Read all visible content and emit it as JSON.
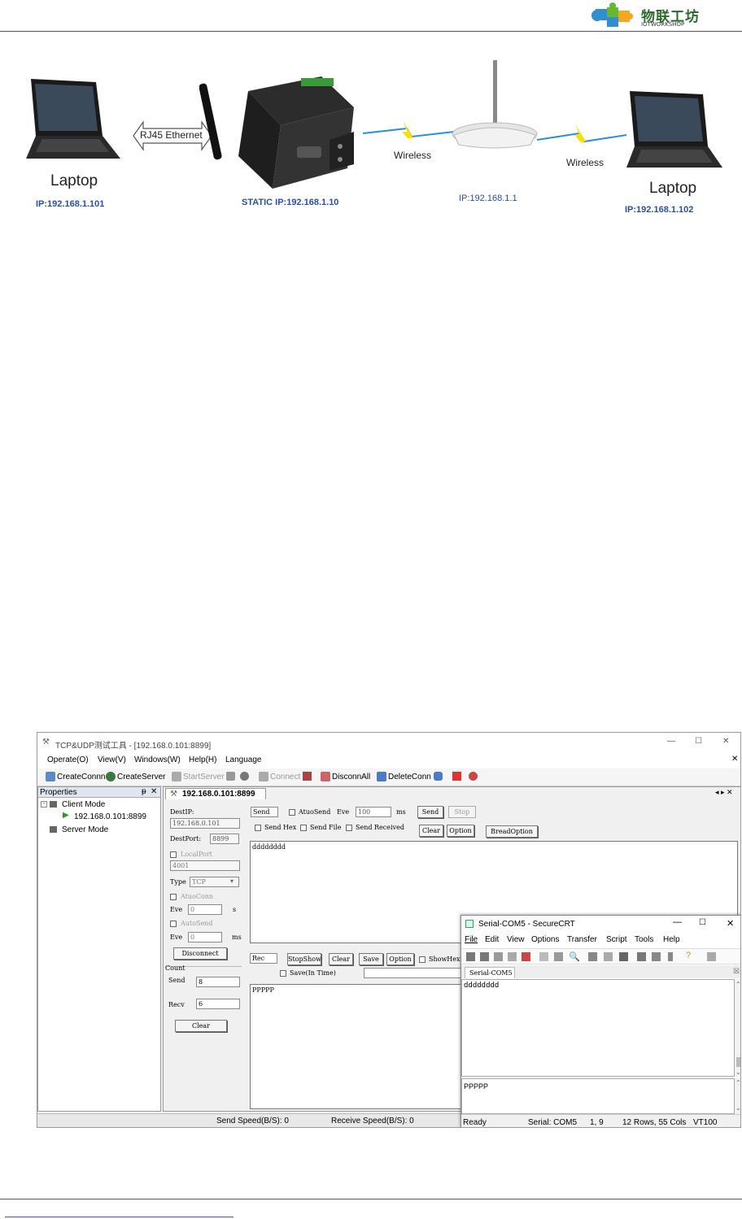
{
  "header": {
    "logo_cn": "物联工坊",
    "logo_en": "IOTWORKSHOP"
  },
  "diagram": {
    "left_label": "Laptop",
    "left_ip": "IP:192.168.1.101",
    "link_label": "RJ45 Ethernet",
    "device_ip": "STATIC IP:192.168.1.10",
    "wireless1": "Wireless",
    "router_ip": "IP:192.168.1.1",
    "wireless2": "Wireless",
    "right_label": "Laptop",
    "right_ip": "IP:192.168.1.102"
  },
  "tcp_tool": {
    "title": "TCP&UDP测试工具 - [192.168.0.101:8899]",
    "window_controls": [
      "—",
      "☐",
      "✕"
    ],
    "menu": [
      "Operate(O)",
      "View(V)",
      "Windows(W)",
      "Help(H)",
      "Language"
    ],
    "toolbar": [
      "CreateConnn",
      "CreateServer",
      "StartServer",
      "Connect",
      "DisconnAll",
      "DeleteConn"
    ],
    "properties_title": "Properties",
    "tree": {
      "client_mode": "Client Mode",
      "connection": "192.168.0.101:8899",
      "server_mode": "Server Mode"
    },
    "tab": "192.168.0.101:8899",
    "dest_ip_label": "DestIP:",
    "dest_ip": "192.168.0.101",
    "dest_port_label": "DestPort:",
    "dest_port": "8899",
    "local_port_label": "LocalPort",
    "local_port": "4001",
    "type_label": "Type",
    "type_value": "TCP",
    "auto_conn_label": "AtuoConn",
    "eve_label": "Eve",
    "eve_value": "0",
    "s_unit": "s",
    "auto_send_label": "AutoSend",
    "eve2_value": "0",
    "ms_unit": "ms",
    "disconnect": "Disconnect",
    "count_label": "Count",
    "send_label": "Send",
    "send_count": "8",
    "recv_label": "Recv",
    "recv_count": "6",
    "clear_left": "Clear",
    "send_box_label": "Send",
    "auto_send2": "AtuoSend",
    "eve3": "Eve",
    "interval": "100",
    "ms2": "ms",
    "send_btn": "Send",
    "stop_btn": "Stop",
    "send_hex": "Send Hex",
    "send_file": "Send File",
    "send_received": "Send Received",
    "clear_btn": "Clear",
    "option_btn": "Option",
    "bread_option": "BreadOption",
    "send_text": "dddddddd",
    "rec_label": "Rec",
    "stop_show": "StopShow",
    "clear2": "Clear",
    "save": "Save",
    "option2": "Option",
    "show_hex": "ShowHex",
    "save_in_time": "Save(In Time)",
    "recv_text": "PPPPP",
    "send_speed": "Send Speed(B/S): 0",
    "recv_speed": "Receive Speed(B/S): 0"
  },
  "securecrt": {
    "title": "Serial-COM5 - SecureCRT",
    "menu": [
      "File",
      "Edit",
      "View",
      "Options",
      "Transfer",
      "Script",
      "Tools",
      "Help"
    ],
    "tab": "Serial-COM5",
    "output": "dddddddd",
    "input": "PPPPP",
    "status": [
      "Ready",
      "Serial: COM5",
      "1,  9",
      "12 Rows,  55 Cols",
      "VT100"
    ]
  }
}
